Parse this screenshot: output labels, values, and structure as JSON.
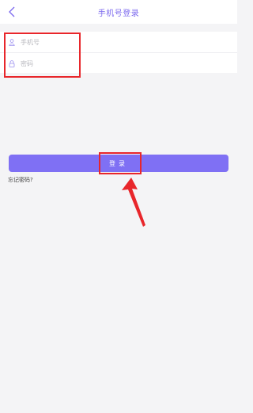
{
  "header": {
    "title": "手机号登录"
  },
  "form": {
    "phone_placeholder": "手机号",
    "password_placeholder": "密码"
  },
  "actions": {
    "login_label": "登录",
    "forgot_label": "忘记密码?"
  },
  "colors": {
    "accent": "#7f70f4",
    "annotation": "#e8262b"
  },
  "icons": {
    "back": "chevron-left-icon",
    "phone": "user-icon",
    "password": "lock-icon"
  }
}
